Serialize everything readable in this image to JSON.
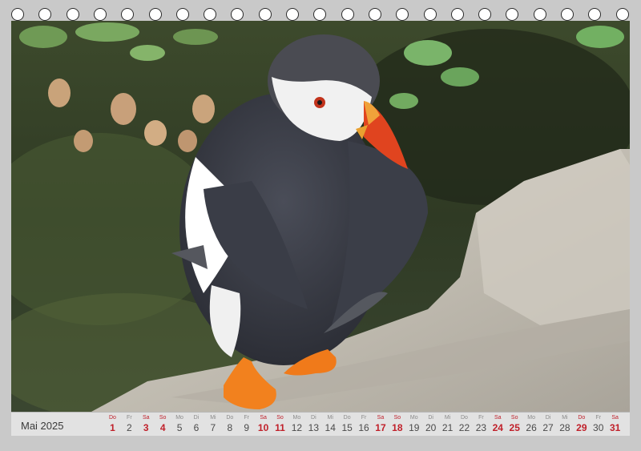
{
  "calendar": {
    "month_label": "Mai 2025",
    "weekend_color": "#c0202a",
    "days": [
      {
        "wd": "Do",
        "num": "1",
        "weekend": true
      },
      {
        "wd": "Fr",
        "num": "2",
        "weekend": false
      },
      {
        "wd": "Sa",
        "num": "3",
        "weekend": true
      },
      {
        "wd": "So",
        "num": "4",
        "weekend": true
      },
      {
        "wd": "Mo",
        "num": "5",
        "weekend": false
      },
      {
        "wd": "Di",
        "num": "6",
        "weekend": false
      },
      {
        "wd": "Mi",
        "num": "7",
        "weekend": false
      },
      {
        "wd": "Do",
        "num": "8",
        "weekend": false
      },
      {
        "wd": "Fr",
        "num": "9",
        "weekend": false
      },
      {
        "wd": "Sa",
        "num": "10",
        "weekend": true
      },
      {
        "wd": "So",
        "num": "11",
        "weekend": true
      },
      {
        "wd": "Mo",
        "num": "12",
        "weekend": false
      },
      {
        "wd": "Di",
        "num": "13",
        "weekend": false
      },
      {
        "wd": "Mi",
        "num": "14",
        "weekend": false
      },
      {
        "wd": "Do",
        "num": "15",
        "weekend": false
      },
      {
        "wd": "Fr",
        "num": "16",
        "weekend": false
      },
      {
        "wd": "Sa",
        "num": "17",
        "weekend": true
      },
      {
        "wd": "So",
        "num": "18",
        "weekend": true
      },
      {
        "wd": "Mo",
        "num": "19",
        "weekend": false
      },
      {
        "wd": "Di",
        "num": "20",
        "weekend": false
      },
      {
        "wd": "Mi",
        "num": "21",
        "weekend": false
      },
      {
        "wd": "Do",
        "num": "22",
        "weekend": false
      },
      {
        "wd": "Fr",
        "num": "23",
        "weekend": false
      },
      {
        "wd": "Sa",
        "num": "24",
        "weekend": true
      },
      {
        "wd": "So",
        "num": "25",
        "weekend": true
      },
      {
        "wd": "Mo",
        "num": "26",
        "weekend": false
      },
      {
        "wd": "Di",
        "num": "27",
        "weekend": false
      },
      {
        "wd": "Mi",
        "num": "28",
        "weekend": false
      },
      {
        "wd": "Do",
        "num": "29",
        "weekend": true
      },
      {
        "wd": "Fr",
        "num": "30",
        "weekend": false
      },
      {
        "wd": "Sa",
        "num": "31",
        "weekend": true
      }
    ]
  },
  "binding": {
    "ring_count": 23
  }
}
